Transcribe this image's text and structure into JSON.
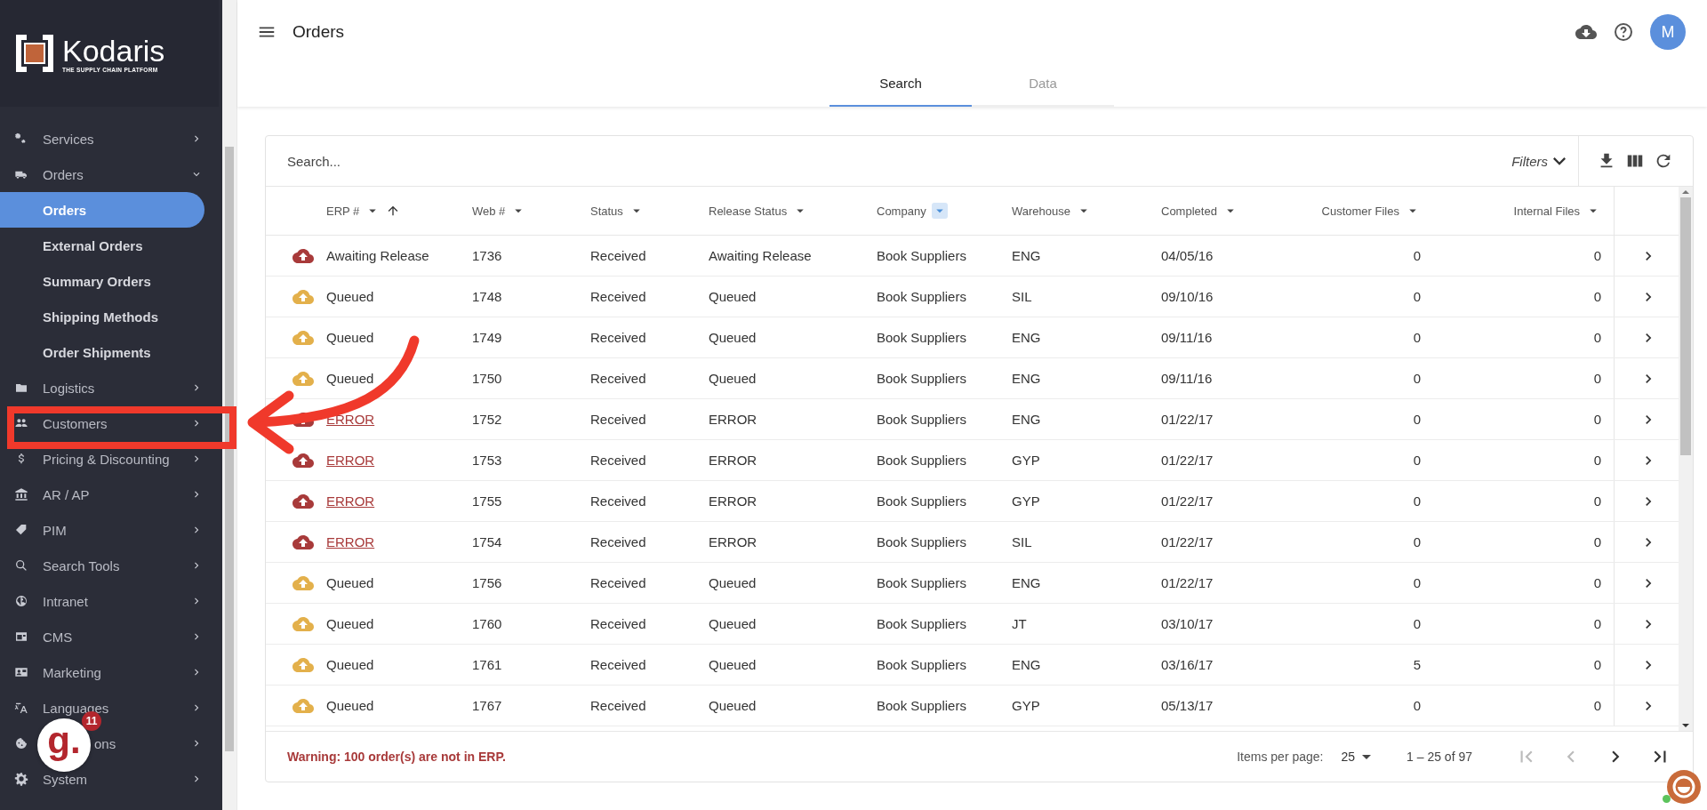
{
  "sidebar": {
    "logo": {
      "name": "Kodaris",
      "tagline": "THE SUPPLY CHAIN PLATFORM"
    },
    "items": [
      {
        "label": "Services",
        "expanded": false
      },
      {
        "label": "Orders",
        "expanded": true,
        "children": [
          {
            "label": "Orders",
            "selected": true
          },
          {
            "label": "External Orders",
            "selected": false
          },
          {
            "label": "Summary Orders",
            "selected": false
          },
          {
            "label": "Shipping Methods",
            "selected": false
          },
          {
            "label": "Order Shipments",
            "selected": false
          }
        ]
      },
      {
        "label": "Logistics",
        "expanded": false
      },
      {
        "label": "Customers",
        "expanded": false
      },
      {
        "label": "Pricing & Discounting",
        "expanded": false
      },
      {
        "label": "AR / AP",
        "expanded": false
      },
      {
        "label": "PIM",
        "expanded": false
      },
      {
        "label": "Search Tools",
        "expanded": false
      },
      {
        "label": "Intranet",
        "expanded": false
      },
      {
        "label": "CMS",
        "expanded": false
      },
      {
        "label": "Marketing",
        "expanded": false
      },
      {
        "label": "Languages",
        "expanded": false
      },
      {
        "label": "ons",
        "expanded": false,
        "behind_widget": true
      },
      {
        "label": "System",
        "expanded": false
      }
    ]
  },
  "header": {
    "title": "Orders",
    "avatar": "M"
  },
  "tabs": [
    {
      "label": "Search",
      "selected": true
    },
    {
      "label": "Data",
      "selected": false
    }
  ],
  "table": {
    "search": {
      "placeholder": "Search..."
    },
    "filters_label": "Filters",
    "columns": [
      {
        "label": "ERP #",
        "sorted": true,
        "filtered": false
      },
      {
        "label": "Web #",
        "sorted": false,
        "filtered": false
      },
      {
        "label": "Status",
        "sorted": false,
        "filtered": false
      },
      {
        "label": "Release Status",
        "sorted": false,
        "filtered": false
      },
      {
        "label": "Company",
        "sorted": false,
        "filtered": true
      },
      {
        "label": "Warehouse",
        "sorted": false,
        "filtered": false
      },
      {
        "label": "Completed",
        "sorted": false,
        "filtered": false
      },
      {
        "label": "Customer Files",
        "sorted": false,
        "filtered": false
      },
      {
        "label": "Internal Files",
        "sorted": false,
        "filtered": false
      }
    ],
    "rows": [
      {
        "kind": "awaiting",
        "erp": "Awaiting Release",
        "web": "1736",
        "status": "Received",
        "release": "Awaiting Release",
        "company": "Book Suppliers",
        "warehouse": "ENG",
        "completed": "04/05/16",
        "customer_files": "0",
        "internal_files": "0"
      },
      {
        "kind": "queued",
        "erp": "Queued",
        "web": "1748",
        "status": "Received",
        "release": "Queued",
        "company": "Book Suppliers",
        "warehouse": "SIL",
        "completed": "09/10/16",
        "customer_files": "0",
        "internal_files": "0"
      },
      {
        "kind": "queued",
        "erp": "Queued",
        "web": "1749",
        "status": "Received",
        "release": "Queued",
        "company": "Book Suppliers",
        "warehouse": "ENG",
        "completed": "09/11/16",
        "customer_files": "0",
        "internal_files": "0"
      },
      {
        "kind": "queued",
        "erp": "Queued",
        "web": "1750",
        "status": "Received",
        "release": "Queued",
        "company": "Book Suppliers",
        "warehouse": "ENG",
        "completed": "09/11/16",
        "customer_files": "0",
        "internal_files": "0"
      },
      {
        "kind": "error",
        "erp": "ERROR",
        "web": "1752",
        "status": "Received",
        "release": "ERROR",
        "company": "Book Suppliers",
        "warehouse": "ENG",
        "completed": "01/22/17",
        "customer_files": "0",
        "internal_files": "0"
      },
      {
        "kind": "error",
        "erp": "ERROR",
        "web": "1753",
        "status": "Received",
        "release": "ERROR",
        "company": "Book Suppliers",
        "warehouse": "GYP",
        "completed": "01/22/17",
        "customer_files": "0",
        "internal_files": "0"
      },
      {
        "kind": "error",
        "erp": "ERROR",
        "web": "1755",
        "status": "Received",
        "release": "ERROR",
        "company": "Book Suppliers",
        "warehouse": "GYP",
        "completed": "01/22/17",
        "customer_files": "0",
        "internal_files": "0"
      },
      {
        "kind": "error",
        "erp": "ERROR",
        "web": "1754",
        "status": "Received",
        "release": "ERROR",
        "company": "Book Suppliers",
        "warehouse": "SIL",
        "completed": "01/22/17",
        "customer_files": "0",
        "internal_files": "0"
      },
      {
        "kind": "queued",
        "erp": "Queued",
        "web": "1756",
        "status": "Received",
        "release": "Queued",
        "company": "Book Suppliers",
        "warehouse": "ENG",
        "completed": "01/22/17",
        "customer_files": "0",
        "internal_files": "0"
      },
      {
        "kind": "queued",
        "erp": "Queued",
        "web": "1760",
        "status": "Received",
        "release": "Queued",
        "company": "Book Suppliers",
        "warehouse": "JT",
        "completed": "03/10/17",
        "customer_files": "0",
        "internal_files": "0"
      },
      {
        "kind": "queued",
        "erp": "Queued",
        "web": "1761",
        "status": "Received",
        "release": "Queued",
        "company": "Book Suppliers",
        "warehouse": "ENG",
        "completed": "03/16/17",
        "customer_files": "5",
        "internal_files": "0"
      },
      {
        "kind": "queued",
        "erp": "Queued",
        "web": "1767",
        "status": "Received",
        "release": "Queued",
        "company": "Book Suppliers",
        "warehouse": "GYP",
        "completed": "05/13/17",
        "customer_files": "0",
        "internal_files": "0"
      }
    ],
    "footer": {
      "warning": "Warning: 100 order(s) are not in ERP.",
      "items_per_page_label": "Items per page:",
      "items_per_page": "25",
      "range": "1 – 25 of 97",
      "pager": [
        {
          "kind": "first",
          "disabled": true
        },
        {
          "kind": "prev",
          "disabled": true
        },
        {
          "kind": "next",
          "disabled": false
        },
        {
          "kind": "last",
          "disabled": false
        }
      ]
    }
  },
  "widget": {
    "logo": "g.",
    "badge": "11"
  }
}
